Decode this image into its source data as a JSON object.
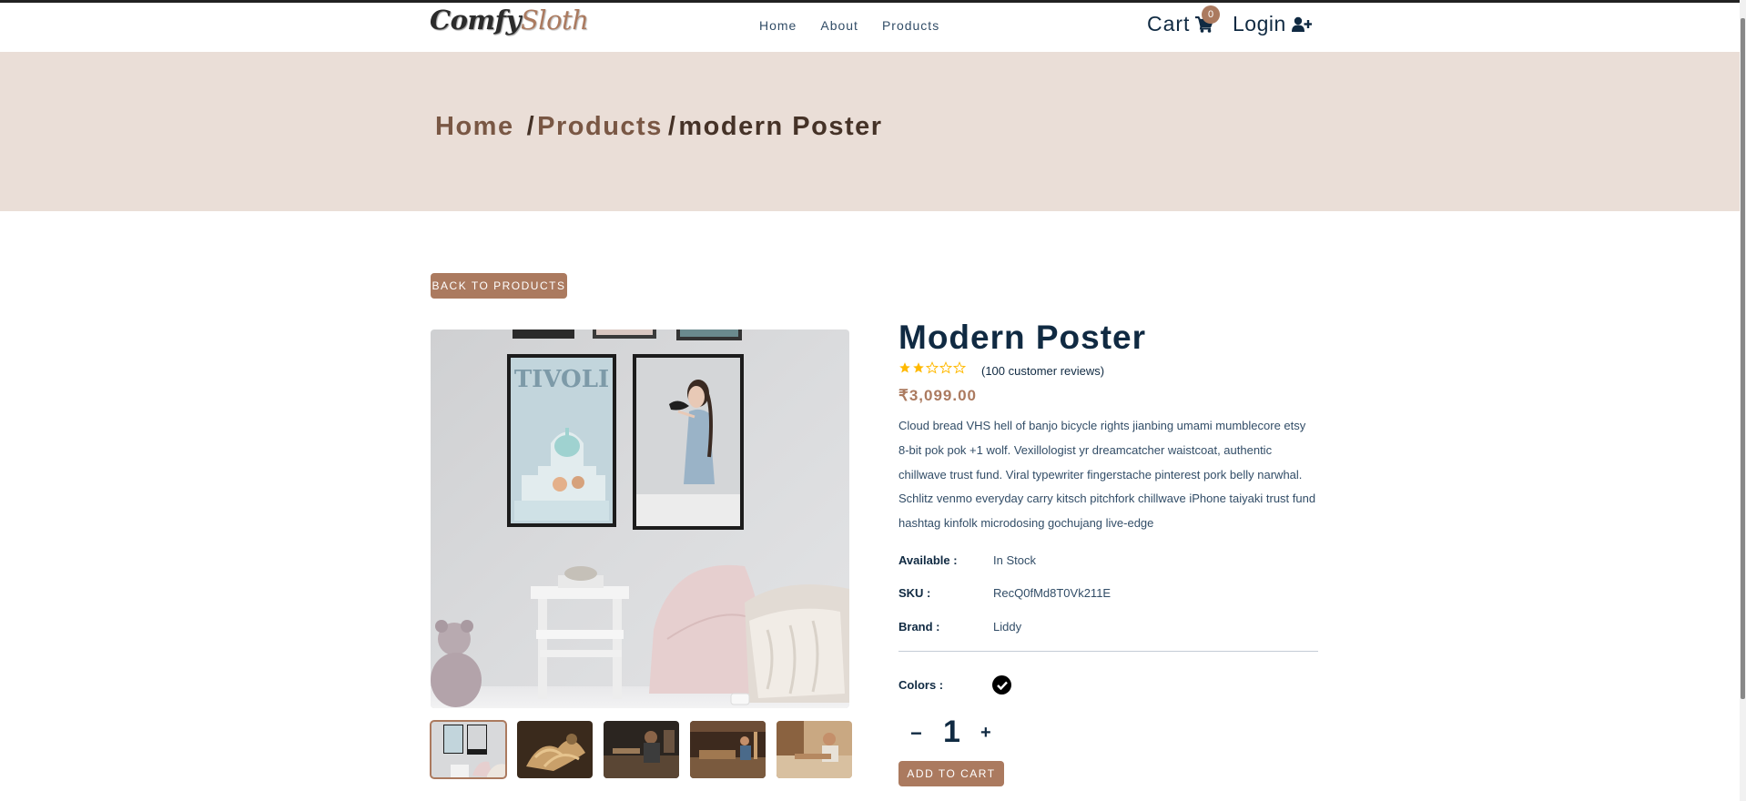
{
  "brand": {
    "logo_part1": "Comfy",
    "logo_part2": "Sloth"
  },
  "nav": {
    "links": [
      "Home",
      "About",
      "Products"
    ]
  },
  "header": {
    "cart_label": "Cart",
    "cart_count": "0",
    "login_label": "Login"
  },
  "breadcrumb": {
    "home": "Home",
    "separator1": "/",
    "products": "Products",
    "separator2": "/",
    "current": "modern Poster"
  },
  "back_button": "back to products",
  "product": {
    "title": "Modern Poster",
    "rating": 2,
    "rating_max": 5,
    "reviews_text": "(100 customer reviews)",
    "price": "₹3,099.00",
    "description": "Cloud bread VHS hell of banjo bicycle rights jianbing umami mumblecore etsy 8-bit pok pok +1 wolf. Vexillologist yr dreamcatcher waistcoat, authentic chillwave trust fund. Viral typewriter fingerstache pinterest pork belly narwhal. Schlitz venmo everyday carry kitsch pitchfork chillwave iPhone taiyaki trust fund hashtag kinfolk microdosing gochujang live-edge",
    "available_label": "Available :",
    "available_value": "In Stock",
    "sku_label": "SKU :",
    "sku_value": "RecQ0fMd8T0Vk211E",
    "brand_label": "Brand :",
    "brand_value": "Liddy",
    "colors_label": "Colors :",
    "colors": [
      "#000000"
    ],
    "quantity": "1",
    "qty_minus": "−",
    "qty_plus": "+",
    "add_to_cart": "add to cart"
  },
  "colors": {
    "accent": "#ab7a5f",
    "hero_bg": "#eaded7",
    "heading": "#102a42",
    "star": "#ffb900"
  }
}
